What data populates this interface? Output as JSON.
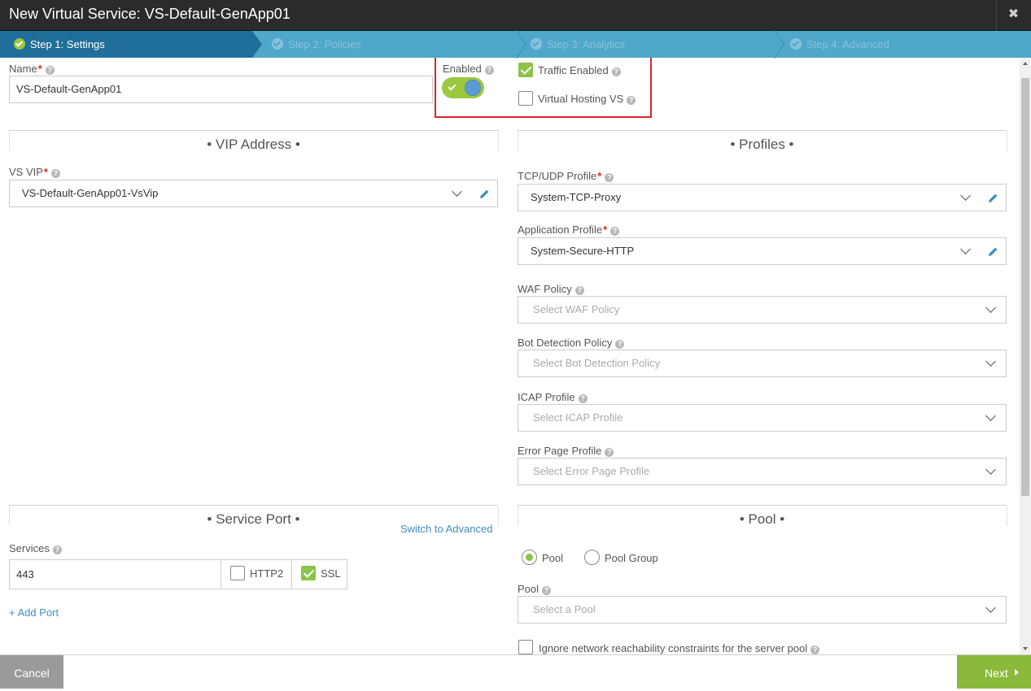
{
  "window": {
    "title": "New Virtual Service: VS-Default-GenApp01",
    "close_glyph": "✖"
  },
  "steps": [
    {
      "label": "Step 1: Settings",
      "active": true
    },
    {
      "label": "Step 2: Policies",
      "active": false
    },
    {
      "label": "Step 3: Analytics",
      "active": false
    },
    {
      "label": "Step 4: Advanced",
      "active": false
    }
  ],
  "settings": {
    "name_label": "Name",
    "name_value": "VS-Default-GenApp01",
    "enabled_label": "Enabled",
    "enabled": true,
    "traffic_enabled_label": "Traffic Enabled",
    "traffic_enabled": true,
    "virtual_hosting_label": "Virtual Hosting VS",
    "virtual_hosting": false
  },
  "vip_section": {
    "title": "• VIP Address •",
    "vs_vip_label": "VS VIP",
    "vs_vip_value": "VS-Default-GenApp01-VsVip"
  },
  "profiles_section": {
    "title": "• Profiles •",
    "tcp_udp_label": "TCP/UDP Profile",
    "tcp_udp_value": "System-TCP-Proxy",
    "app_profile_label": "Application Profile",
    "app_profile_value": "System-Secure-HTTP",
    "waf_label": "WAF Policy",
    "waf_placeholder": "Select WAF Policy",
    "bot_label": "Bot Detection Policy",
    "bot_placeholder": "Select Bot Detection Policy",
    "icap_label": "ICAP Profile",
    "icap_placeholder": "Select ICAP Profile",
    "error_page_label": "Error Page Profile",
    "error_page_placeholder": "Select Error Page Profile"
  },
  "service_port_section": {
    "title": "• Service Port •",
    "switch_link": "Switch to Advanced",
    "services_label": "Services",
    "port_value": "443",
    "http2_label": "HTTP2",
    "http2": false,
    "ssl_label": "SSL",
    "ssl": true,
    "add_port_link": "+ Add Port"
  },
  "pool_section": {
    "title": "• Pool •",
    "radio_pool_label": "Pool",
    "radio_pool_group_label": "Pool Group",
    "selected": "Pool",
    "pool_label": "Pool",
    "pool_placeholder": "Select a Pool",
    "ignore_label": "Ignore network reachability constraints for the server pool",
    "ignore": false
  },
  "footer": {
    "cancel_label": "Cancel",
    "next_label": "Next"
  },
  "colors": {
    "accent_green": "#8bc34a",
    "step_active": "#1f6f9a",
    "step_bar": "#4fa8c9",
    "title_bar": "#2b2b2b",
    "highlight": "#d9242b",
    "link": "#3f8fbf"
  }
}
